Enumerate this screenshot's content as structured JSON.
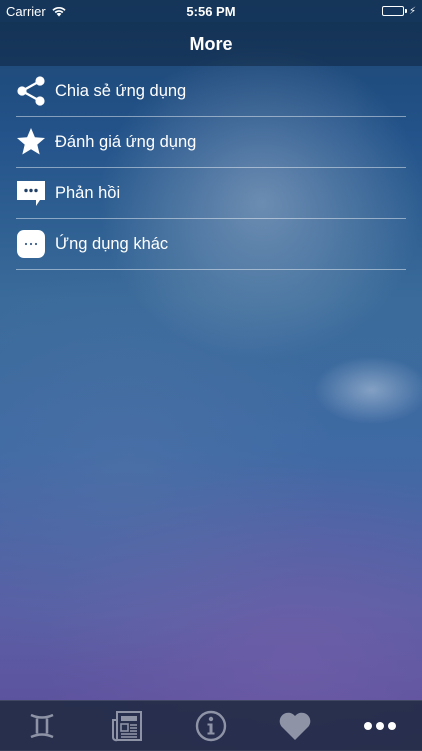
{
  "status_bar": {
    "carrier": "Carrier",
    "time": "5:56 PM",
    "battery_color": "#4cd964"
  },
  "nav": {
    "title": "More"
  },
  "menu": {
    "items": [
      {
        "label": "Chia sẻ ứng dụng",
        "icon": "share-icon"
      },
      {
        "label": "Đánh giá ứng dụng",
        "icon": "star-icon"
      },
      {
        "label": "Phản hồi",
        "icon": "feedback-chat-icon"
      },
      {
        "label": "Ứng dụng khác",
        "icon": "more-apps-icon"
      }
    ]
  },
  "tab_bar": {
    "items": [
      {
        "icon": "gemini-zodiac-icon"
      },
      {
        "icon": "newspaper-icon"
      },
      {
        "icon": "info-icon"
      },
      {
        "icon": "heart-icon"
      },
      {
        "icon": "more-dots-icon",
        "active": true
      }
    ],
    "inactive_color": "#8e93a6",
    "active_color": "#ffffff"
  }
}
